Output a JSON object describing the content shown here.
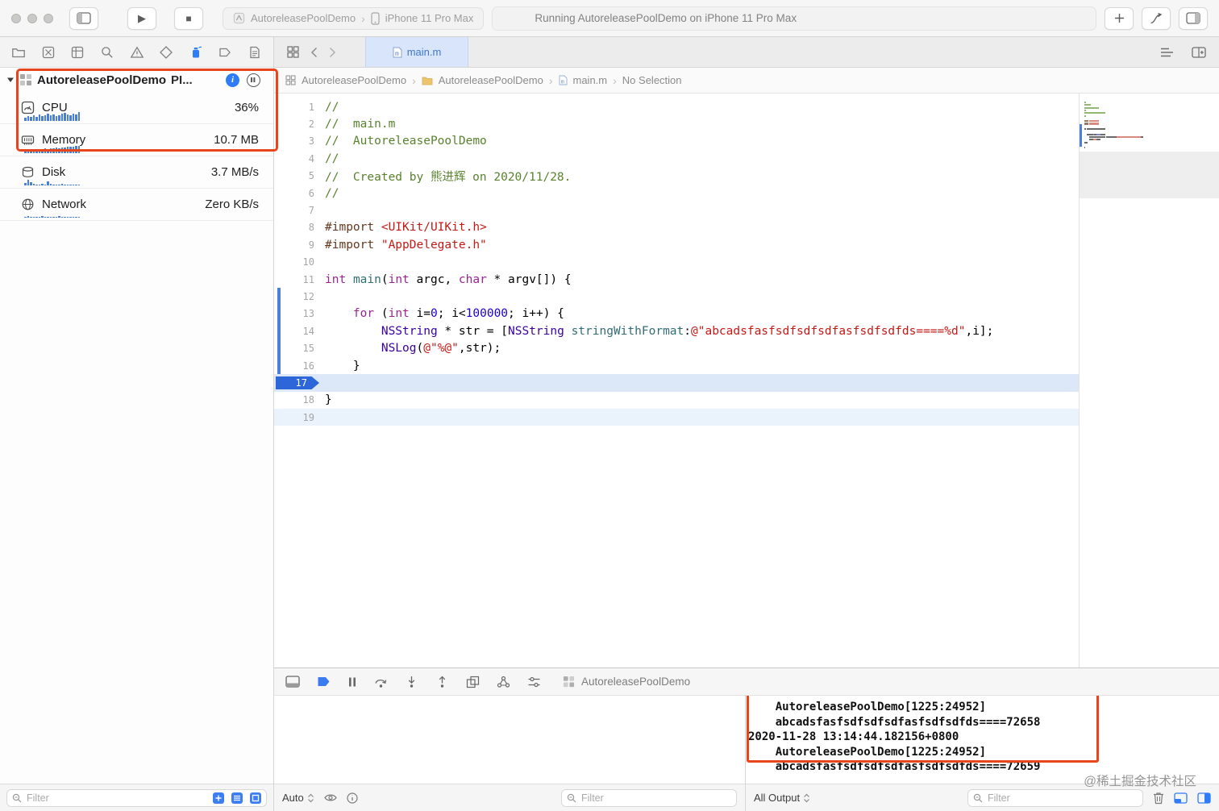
{
  "colors": {
    "annotation_red": "#E8451C",
    "accent_blue": "#2E7CF6",
    "breakpoint_blue": "#2D66D9",
    "line_highlight": "#DCE8F8",
    "cursor_line_highlight": "#EAF2FB",
    "change_bar_blue": "#4B80D6"
  },
  "toolbar": {
    "scheme_app": "AutoreleasePoolDemo",
    "scheme_device": "iPhone 11 Pro Max",
    "status": "Running AutoreleasePoolDemo on iPhone 11 Pro Max"
  },
  "sidebar": {
    "process": {
      "name": "AutoreleasePoolDemo",
      "pid_truncated": "PI..."
    },
    "gauges": [
      {
        "label": "CPU",
        "value": "36%"
      },
      {
        "label": "Memory",
        "value": "10.7 MB"
      },
      {
        "label": "Disk",
        "value": "3.7 MB/s"
      },
      {
        "label": "Network",
        "value": "Zero KB/s"
      }
    ],
    "filter_placeholder": "Filter"
  },
  "editor": {
    "tab_title": "main.m",
    "breadcrumbs": [
      "AutoreleasePoolDemo",
      "AutoreleasePoolDemo",
      "main.m",
      "No Selection"
    ],
    "code": {
      "palette": {
        "pln": "#000000",
        "kw": "#9B2393",
        "type": "#3900A0",
        "fn": "#326D74",
        "str": "#C41A16",
        "num": "#1C00CF",
        "cmt": "#59822E",
        "pre": "#643820"
      },
      "lines": [
        {
          "num": 1,
          "seg": [
            {
              "t": "//",
              "c": "cmt"
            }
          ]
        },
        {
          "num": 2,
          "seg": [
            {
              "t": "//  main.m",
              "c": "cmt"
            }
          ]
        },
        {
          "num": 3,
          "seg": [
            {
              "t": "//  AutoreleasePoolDemo",
              "c": "cmt"
            }
          ]
        },
        {
          "num": 4,
          "seg": [
            {
              "t": "//",
              "c": "cmt"
            }
          ]
        },
        {
          "num": 5,
          "seg": [
            {
              "t": "//  Created by 熊进辉 on 2020/11/28.",
              "c": "cmt"
            }
          ]
        },
        {
          "num": 6,
          "seg": [
            {
              "t": "//",
              "c": "cmt"
            }
          ]
        },
        {
          "num": 7,
          "seg": []
        },
        {
          "num": 8,
          "seg": [
            {
              "t": "#import",
              "c": "pre"
            },
            {
              "t": " ",
              "c": "pln"
            },
            {
              "t": "<UIKit/UIKit.h>",
              "c": "str"
            }
          ]
        },
        {
          "num": 9,
          "seg": [
            {
              "t": "#import",
              "c": "pre"
            },
            {
              "t": " ",
              "c": "pln"
            },
            {
              "t": "\"AppDelegate.h\"",
              "c": "str"
            }
          ]
        },
        {
          "num": 10,
          "seg": []
        },
        {
          "num": 11,
          "seg": [
            {
              "t": "int",
              "c": "kw"
            },
            {
              "t": " ",
              "c": "pln"
            },
            {
              "t": "main",
              "c": "fn"
            },
            {
              "t": "(",
              "c": "pln"
            },
            {
              "t": "int",
              "c": "kw"
            },
            {
              "t": " argc, ",
              "c": "pln"
            },
            {
              "t": "char",
              "c": "kw"
            },
            {
              "t": " * argv[]) {",
              "c": "pln"
            }
          ]
        },
        {
          "num": 12,
          "changed": true,
          "seg": []
        },
        {
          "num": 13,
          "changed": true,
          "seg": [
            {
              "t": "    ",
              "c": "pln"
            },
            {
              "t": "for",
              "c": "kw"
            },
            {
              "t": " (",
              "c": "pln"
            },
            {
              "t": "int",
              "c": "kw"
            },
            {
              "t": " i=",
              "c": "pln"
            },
            {
              "t": "0",
              "c": "num"
            },
            {
              "t": "; i<",
              "c": "pln"
            },
            {
              "t": "100000",
              "c": "num"
            },
            {
              "t": "; i++) {",
              "c": "pln"
            }
          ]
        },
        {
          "num": 14,
          "changed": true,
          "seg": [
            {
              "t": "        ",
              "c": "pln"
            },
            {
              "t": "NSString",
              "c": "type"
            },
            {
              "t": " * str = [",
              "c": "pln"
            },
            {
              "t": "NSString",
              "c": "type"
            },
            {
              "t": " ",
              "c": "pln"
            },
            {
              "t": "stringWithFormat",
              "c": "fn"
            },
            {
              "t": ":",
              "c": "pln"
            },
            {
              "t": "@\"abcadsfasfsdfsdfsdfasfsdfsdfds====%d\"",
              "c": "str"
            },
            {
              "t": ",i];",
              "c": "pln"
            }
          ]
        },
        {
          "num": 15,
          "changed": true,
          "seg": [
            {
              "t": "        ",
              "c": "pln"
            },
            {
              "t": "NSLog",
              "c": "type"
            },
            {
              "t": "(",
              "c": "pln"
            },
            {
              "t": "@\"%@\"",
              "c": "str"
            },
            {
              "t": ",str);",
              "c": "pln"
            }
          ]
        },
        {
          "num": 16,
          "changed": true,
          "seg": [
            {
              "t": "    }",
              "c": "pln"
            }
          ]
        },
        {
          "num": 17,
          "breakpoint": true,
          "highlight": "bp",
          "seg": []
        },
        {
          "num": 18,
          "seg": [
            {
              "t": "}",
              "c": "pln"
            }
          ]
        },
        {
          "num": 19,
          "highlight": "cursor",
          "seg": []
        }
      ]
    }
  },
  "debug": {
    "toolbar_process": "AutoreleasePoolDemo",
    "variables_scope": "Auto",
    "variables_filter_placeholder": "Filter",
    "console_scope": "All Output",
    "console_filter_placeholder": "Filter",
    "console_lines": [
      "    AutoreleasePoolDemo[1225:24952]",
      "    abcadsfasfsdfsdfsdfasfsdfsdfds====72658",
      "2020-11-28 13:14:44.182156+0800",
      "    AutoreleasePoolDemo[1225:24952]",
      "    abcadsfasfsdfsdfsdfasfsdfsdfds====72659"
    ]
  },
  "watermark": "@稀土掘金技术社区"
}
